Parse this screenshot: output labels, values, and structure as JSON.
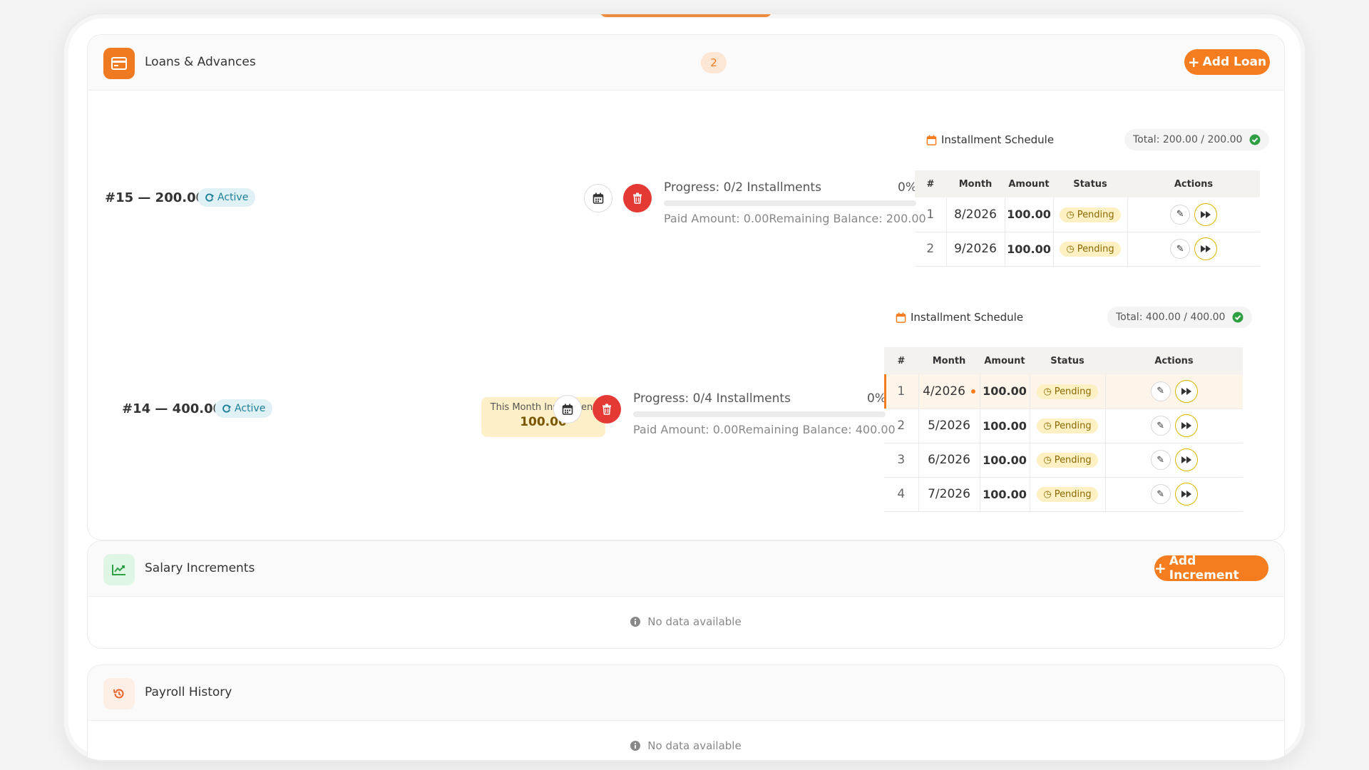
{
  "loans_card": {
    "title": "Loans & Advances",
    "count": "2",
    "add_label": "Add Loan",
    "loans": [
      {
        "id_label": "#15 — 200.00",
        "status": "Active",
        "progress_label": "Progress: 0/2 Installments",
        "progress_pct": "0%",
        "progress_fraction": 0,
        "paid_remaining": "Paid Amount: 0.00Remaining Balance: 200.00",
        "schedule_title": "Installment Schedule",
        "total": "Total: 200.00 / 200.00",
        "rows": [
          {
            "n": "1",
            "month": "8/2026",
            "amount": "100.00",
            "status": "Pending"
          },
          {
            "n": "2",
            "month": "9/2026",
            "amount": "100.00",
            "status": "Pending"
          }
        ]
      },
      {
        "id_label": "#14 — 400.00",
        "status": "Active",
        "this_month_label": "This Month Installment",
        "this_month_value": "100.00",
        "progress_label": "Progress: 0/4 Installments",
        "progress_pct": "0%",
        "progress_fraction": 0,
        "paid_remaining": "Paid Amount: 0.00Remaining Balance: 400.00",
        "schedule_title": "Installment Schedule",
        "total": "Total: 400.00 / 400.00",
        "rows": [
          {
            "n": "1",
            "month": "4/2026",
            "amount": "100.00",
            "status": "Pending"
          },
          {
            "n": "2",
            "month": "5/2026",
            "amount": "100.00",
            "status": "Pending"
          },
          {
            "n": "3",
            "month": "6/2026",
            "amount": "100.00",
            "status": "Pending"
          },
          {
            "n": "4",
            "month": "7/2026",
            "amount": "100.00",
            "status": "Pending"
          }
        ]
      }
    ],
    "table_headers": {
      "n": "#",
      "month": "Month",
      "amount": "Amount",
      "status": "Status",
      "actions": "Actions"
    }
  },
  "increments_card": {
    "title": "Salary Increments",
    "add_label": "Add Increment",
    "empty": "No data available"
  },
  "payroll_card": {
    "title": "Payroll History",
    "empty": "No data available"
  },
  "colors": {
    "accent": "#f57c1f",
    "danger": "#e53935",
    "success": "#2ea043",
    "pending_bg": "#fdf0c2",
    "active_bg": "#dff1f5"
  },
  "icons": {
    "loans": "credit-card-icon",
    "increments": "trend-up-icon",
    "payroll": "history-icon",
    "calendar": "calendar-icon",
    "delete": "trash-icon",
    "edit": "pencil-icon",
    "skip": "fast-forward-icon",
    "check": "check-circle-icon",
    "refresh": "refresh-icon",
    "info": "info-icon",
    "plus": "plus-icon"
  }
}
